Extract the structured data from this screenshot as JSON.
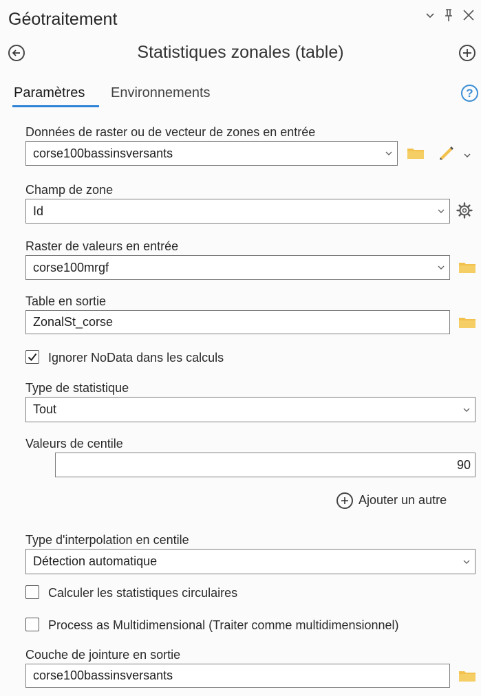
{
  "pane": {
    "title": "Géotraitement",
    "menu_glyph": "⌄",
    "pin_glyph": "ꟸ",
    "close_glyph": "✕"
  },
  "tool": {
    "name": "Statistiques zonales (table)",
    "back_glyph": "←",
    "add_glyph": "+"
  },
  "tabs": {
    "parameters": "Paramètres",
    "environments": "Environnements",
    "help_glyph": "?"
  },
  "form": {
    "zones_input": {
      "label": "Données de raster ou de vecteur de zones en entrée",
      "value": "corse100bassinsversants"
    },
    "zone_field": {
      "label": "Champ de zone",
      "value": "Id"
    },
    "value_raster": {
      "label": "Raster de valeurs en entrée",
      "value": "corse100mrgf"
    },
    "output_table": {
      "label": "Table en sortie",
      "value": "ZonalSt_corse"
    },
    "ignore_nodata": {
      "label": "Ignorer NoData dans les calculs",
      "checked": true
    },
    "statistics_type": {
      "label": "Type de statistique",
      "value": "Tout"
    },
    "percentile_values": {
      "label": "Valeurs de centile",
      "value": "90",
      "add_another": "Ajouter un autre"
    },
    "percentile_interpolation": {
      "label": "Type d'interpolation en centile",
      "value": "Détection automatique"
    },
    "circular_stats": {
      "label": "Calculer les statistiques circulaires",
      "checked": false
    },
    "multidimensional": {
      "label": "Process as Multidimensional (Traiter comme multidimensionnel)",
      "checked": false
    },
    "output_join_layer": {
      "label": "Couche de jointure en sortie",
      "value": "corse100bassinsversants"
    }
  },
  "colors": {
    "accent": "#2e82d6",
    "folder": "#f2c14e"
  }
}
